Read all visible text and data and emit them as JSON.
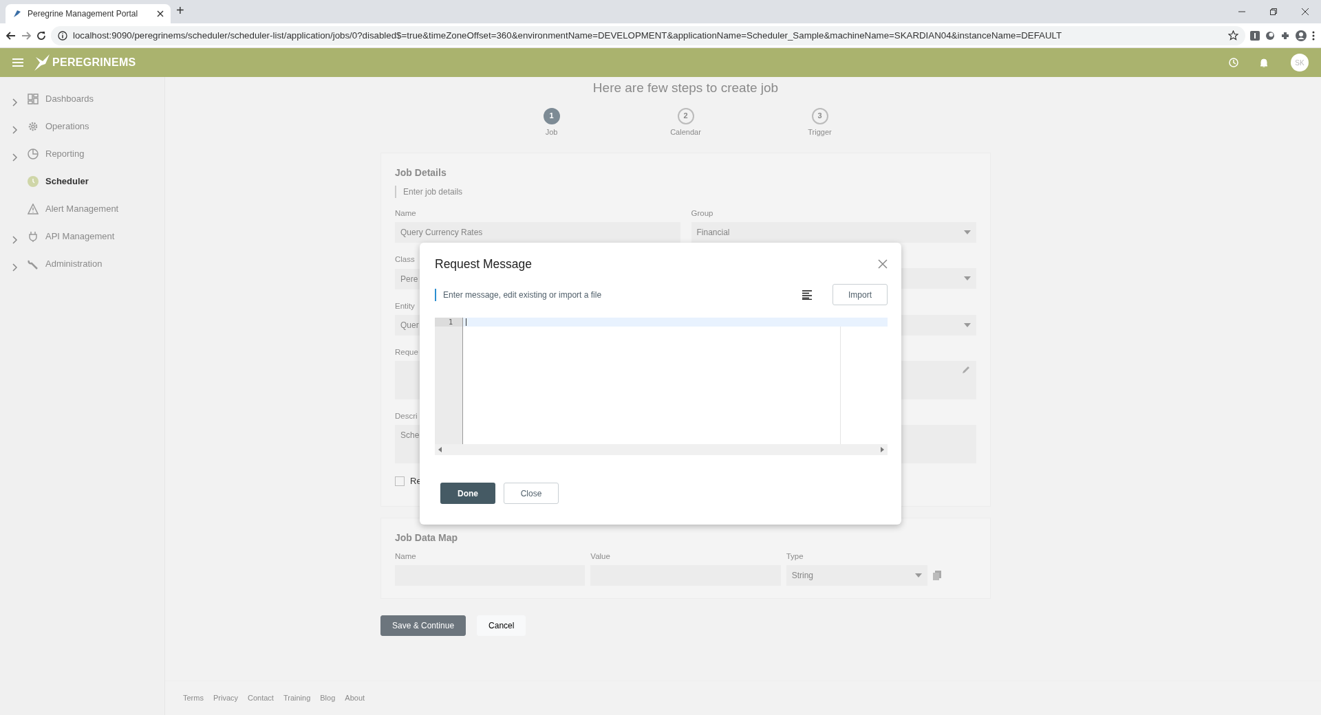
{
  "browser": {
    "tab_title": "Peregrine Management Portal",
    "new_tab": "+",
    "url": "localhost:9090/peregrinems/scheduler/scheduler-list/application/jobs/0?disabled$=true&timeZoneOffset=360&environmentName=DEVELOPMENT&applicationName=Scheduler_Sample&machineName=SKARDIAN04&instanceName=DEFAULT"
  },
  "app": {
    "brand": "PEREGRINEMS",
    "avatar": "SK"
  },
  "sidebar": {
    "items": [
      {
        "label": "Dashboards",
        "expandable": true,
        "selected": false
      },
      {
        "label": "Operations",
        "expandable": true,
        "selected": false
      },
      {
        "label": "Reporting",
        "expandable": true,
        "selected": false
      },
      {
        "label": "Scheduler",
        "expandable": false,
        "selected": true
      },
      {
        "label": "Alert Management",
        "expandable": false,
        "selected": false
      },
      {
        "label": "API Management",
        "expandable": true,
        "selected": false
      },
      {
        "label": "Administration",
        "expandable": true,
        "selected": false
      }
    ]
  },
  "wizard": {
    "heading": "Here are few steps to create job",
    "steps": [
      {
        "number": "1",
        "label": "Job",
        "selected": true
      },
      {
        "number": "2",
        "label": "Calendar",
        "selected": false
      },
      {
        "number": "3",
        "label": "Trigger",
        "selected": false
      }
    ]
  },
  "job_details": {
    "title": "Job Details",
    "subtitle": "Enter job details",
    "fields": [
      {
        "kind": "text",
        "label": "Name",
        "value": "Query Currency Rates"
      },
      {
        "kind": "select",
        "label": "Group",
        "value": "Financial"
      },
      {
        "kind": "text",
        "label": "Class",
        "value": "Pere"
      },
      {
        "kind": "select"
      },
      {
        "kind": "text",
        "label": "Entity",
        "value": "Quer"
      },
      {
        "kind": "select"
      },
      {
        "kind": "textarea",
        "label": "Reque"
      },
      {
        "kind": "textarea",
        "label": "Descri",
        "value": "Sche"
      },
      {
        "kind": "checkbox",
        "label": "Re",
        "checked": false
      }
    ]
  },
  "job_data_map": {
    "title": "Job Data Map",
    "columns": [
      "Name",
      "Value",
      "Type"
    ],
    "type_value": "String"
  },
  "actions": [
    {
      "label": "Save & Continue",
      "kind": "primary"
    },
    {
      "label": "Cancel",
      "kind": "secondary"
    }
  ],
  "footer": {
    "links": [
      "Terms",
      "Privacy",
      "Contact",
      "Training",
      "Blog",
      "About"
    ]
  },
  "modal": {
    "title": "Request Message",
    "subtitle": "Enter message, edit existing or import a file",
    "import_button": "Import",
    "line_numbers": [
      "1"
    ],
    "buttons": [
      {
        "label": "Done",
        "kind": "primary"
      },
      {
        "label": "Close",
        "kind": "secondary"
      }
    ]
  }
}
